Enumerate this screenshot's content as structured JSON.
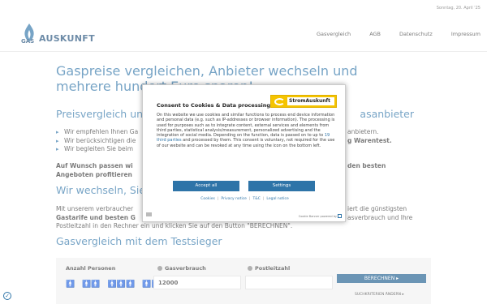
{
  "topbar": {
    "date": "Sonntag, 20. April '25"
  },
  "header": {
    "logo_text": "AUSKUNFT",
    "nav": [
      "Gasvergleich",
      "AGB",
      "Datenschutz",
      "Impressum"
    ]
  },
  "main": {
    "h1": "Gaspreise vergleichen, Anbieter wechseln und mehrere hundert Euro sparen!",
    "h2_left": "Preisvergleich und",
    "h2_right": "asanbieter",
    "bullets": [
      "Wir empfehlen Ihnen Ga",
      "Wir berücksichtigen die",
      "Wir begleiten Sie beim"
    ],
    "bullets_right": [
      "anbietern.",
      "g Warentest."
    ],
    "bold_par_left": [
      "Auf Wunsch passen wi",
      "Angeboten profitieren"
    ],
    "bold_par_right": "den besten",
    "h3": "Wir wechseln, Sie",
    "para1_l1": "Mit unserem verbraucher",
    "para1_l2": "Gastarife und besten G",
    "para_right_l1": "iert die günstigsten",
    "para_right_l2": "asverbrauch und Ihre",
    "para2": "Postleitzahl in den Rechner ein und klicken Sie auf den Button \"BERECHNEN\".",
    "h4": "Gasvergleich mit dem Testsieger"
  },
  "calculator": {
    "persons_label": "Anzahl Personen",
    "gas_label": "Gasverbrauch",
    "plz_label": "Postleitzahl",
    "gas_value": "12000",
    "plz_value": "",
    "submit_label": "BERECHNEN ▸",
    "criteria_label": "SUCHKRITERIEN ÄNDERN ▸"
  },
  "cookie_modal": {
    "title": "Consent to Cookies & Data processing",
    "brand": "StromAuskunft",
    "body_pre": "On this website we use cookies and similar functions to process end device information and personal data (e.g. such as IP-addresses or browser information). The processing is used for purposes such as to integrate content, external services and elements from third parties, statistical analysis/measurement, personalized advertising and the integration of social media. Depending on the function, data is passed on to up to ",
    "body_link": "19 third parties",
    "body_post": " and processed by them. This consent is voluntary, not required for the use of our website and can be revoked at any time using the icon on the bottom left.",
    "accept_label": "Accept all",
    "settings_label": "Settings",
    "links": [
      "Cookies",
      "Privacy notice",
      "T&C",
      "Legal notice"
    ],
    "powered_by": "Cookie Banner powered by"
  },
  "colors": {
    "accent": "#2e74a8",
    "dark_blue": "#1c5d8e",
    "brand_yellow": "#f5c400"
  }
}
